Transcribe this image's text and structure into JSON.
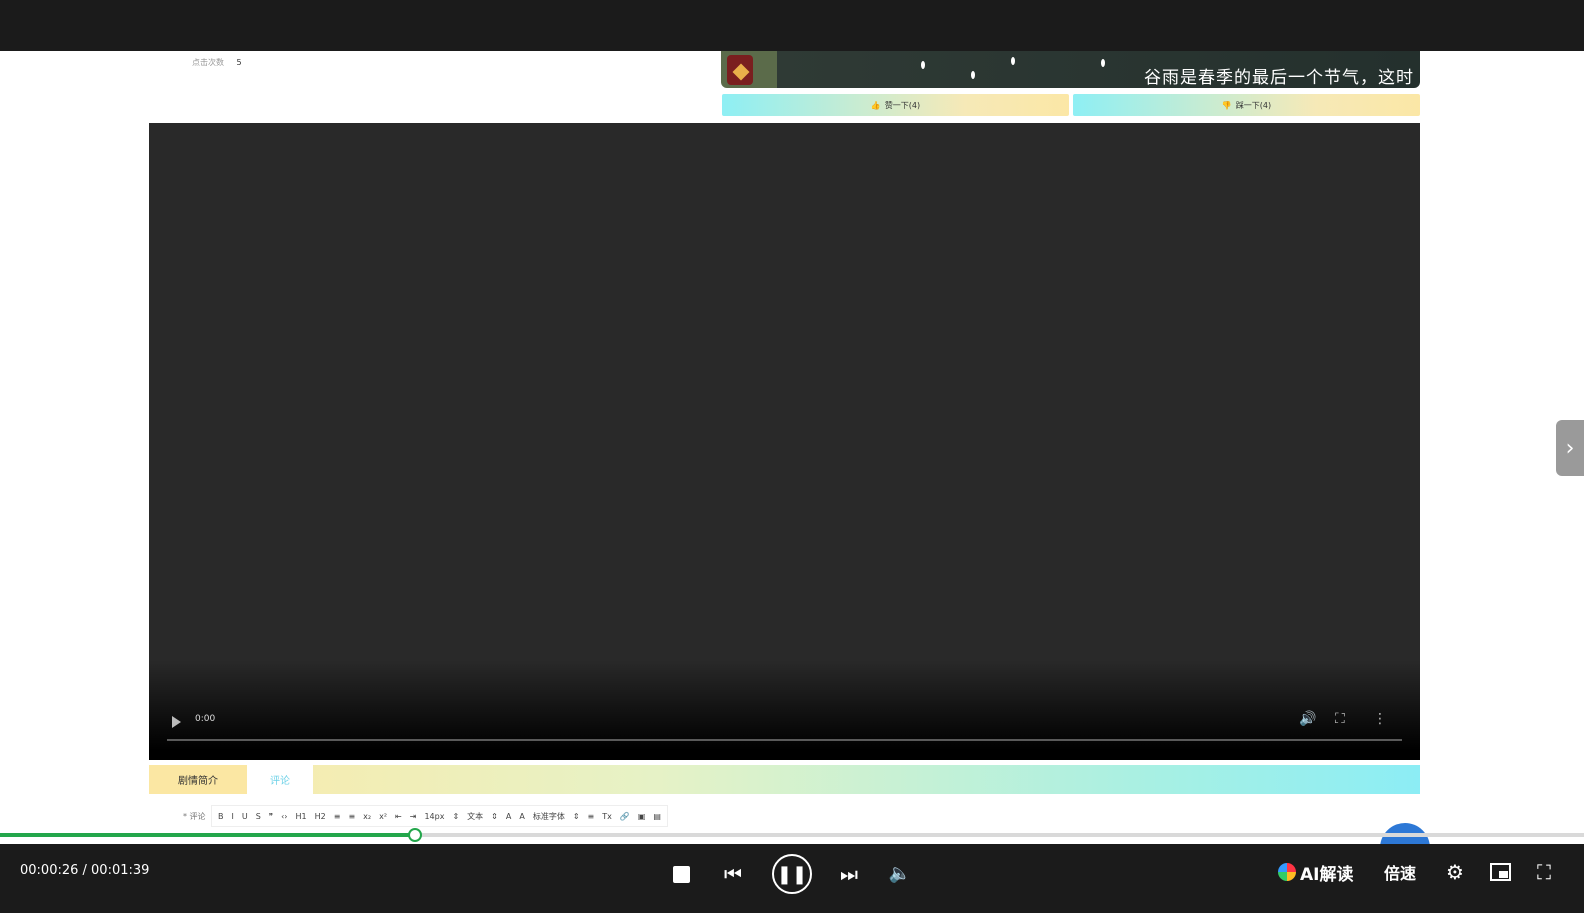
{
  "page": {
    "meta": {
      "label": "点击次数",
      "value": "5"
    },
    "banner": {
      "caption": "谷雨是春季的最后一个节气，这时"
    },
    "votes": [
      {
        "label": "赞一下(4)",
        "icon": "thumbs-up-icon"
      },
      {
        "label": "踩一下(4)",
        "icon": "thumbs-down-icon"
      }
    ],
    "video": {
      "time": "0:00"
    },
    "tabs": [
      {
        "label": "剧情简介"
      },
      {
        "label": "评论"
      }
    ],
    "editor": {
      "label": "* 评论",
      "tools": [
        "B",
        "I",
        "U",
        "S",
        "❞",
        "‹›",
        "H1",
        "H2",
        "≡",
        "≡",
        "x₂",
        "x²",
        "⇤",
        "⇥",
        "14px",
        "⇕",
        "文本",
        "⇕",
        "A",
        "A",
        "标准字体",
        "⇕",
        "≡",
        "Tx",
        "🔗",
        "▣",
        "▤"
      ]
    }
  },
  "player": {
    "time": "00:00:26 / 00:01:39",
    "progress": 0.262,
    "ai_label": "AI解读",
    "speed_label": "倍速"
  },
  "colors": {
    "progress": "#23a64b",
    "bar": "#1b1b1b"
  }
}
